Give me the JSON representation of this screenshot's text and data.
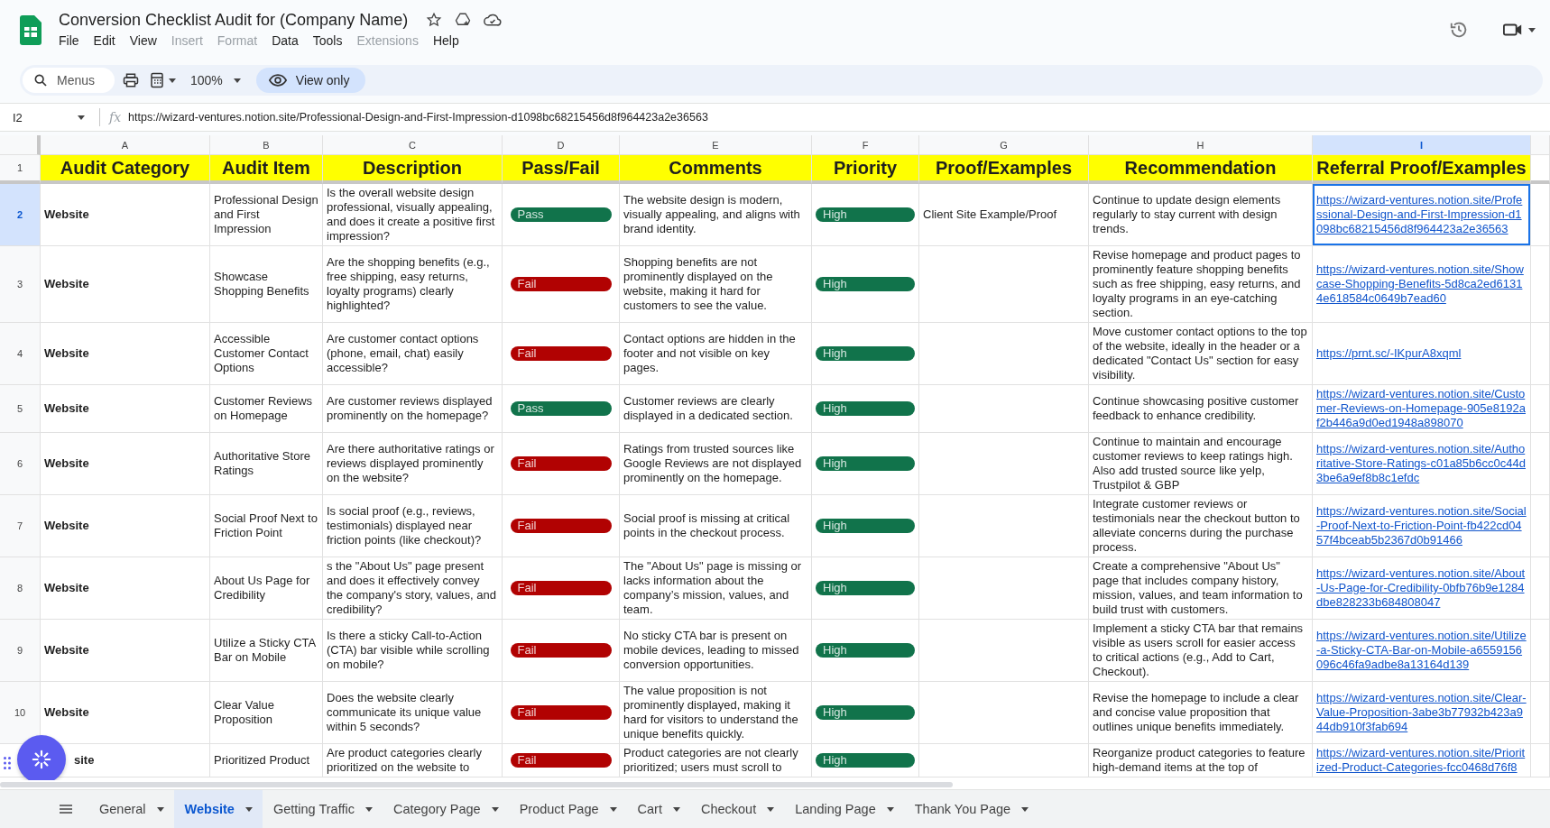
{
  "document": {
    "title": "Conversion Checklist Audit for (Company Name)",
    "menus": [
      {
        "label": "File",
        "disabled": false
      },
      {
        "label": "Edit",
        "disabled": false
      },
      {
        "label": "View",
        "disabled": false
      },
      {
        "label": "Insert",
        "disabled": true
      },
      {
        "label": "Format",
        "disabled": true
      },
      {
        "label": "Data",
        "disabled": false
      },
      {
        "label": "Tools",
        "disabled": false
      },
      {
        "label": "Extensions",
        "disabled": true
      },
      {
        "label": "Help",
        "disabled": false
      }
    ]
  },
  "toolbar": {
    "search": {
      "placeholder": "Menus"
    },
    "zoom": "100%",
    "mode": "View only"
  },
  "formula_bar": {
    "cell": "I2",
    "function_label": "fx",
    "formula": "https://wizard-ventures.notion.site/Professional-Design-and-First-Impression-d1098bc68215456d8f964423a2e36563"
  },
  "sheet": {
    "columns": [
      {
        "letter": "A",
        "selected": false
      },
      {
        "letter": "B",
        "selected": false
      },
      {
        "letter": "C",
        "selected": false
      },
      {
        "letter": "D",
        "selected": false
      },
      {
        "letter": "E",
        "selected": false
      },
      {
        "letter": "F",
        "selected": false
      },
      {
        "letter": "G",
        "selected": false
      },
      {
        "letter": "H",
        "selected": false
      },
      {
        "letter": "I",
        "selected": true
      }
    ],
    "header_row": {
      "number": "1",
      "cells": [
        "Audit Category",
        "Audit Item",
        "Description",
        "Pass/Fail",
        "Comments",
        "Priority",
        "Proof/Examples",
        "Recommendation",
        "Referral Proof/Examples"
      ]
    },
    "rows": [
      {
        "number": "2",
        "selected": true,
        "category": "Website",
        "item": "Professional Design and First Impression",
        "description": "Is the overall website design professional, visually appealing, and does it create a positive first impression?",
        "pass_fail": {
          "label": "Pass",
          "color": "#11734b"
        },
        "comments": "The website design is modern, visually appealing, and aligns with brand identity.",
        "priority": {
          "label": "High",
          "color": "#11734b"
        },
        "proof": "Client Site Example/Proof",
        "recommendation": "Continue to update design elements regularly to stay current with design trends.",
        "referral": {
          "url": "https://wizard-ventures.notion.site/Professional-Design-and-First-Impression-d1098bc68215456d8f964423a2e36563",
          "selected": true
        }
      },
      {
        "number": "3",
        "selected": false,
        "category": "Website",
        "item": "Showcase Shopping Benefits",
        "description": "Are the shopping benefits (e.g., free shipping, easy returns, loyalty programs) clearly highlighted?",
        "pass_fail": {
          "label": "Fail",
          "color": "#b10202"
        },
        "comments": "Shopping benefits are not prominently displayed on the website, making it hard for customers to see the value.",
        "priority": {
          "label": "High",
          "color": "#11734b"
        },
        "recommendation": "Revise homepage and product pages to prominently feature shopping benefits such as free shipping, easy returns, and loyalty programs in an eye-catching section.",
        "referral": {
          "url": "https://wizard-ventures.notion.site/Showcase-Shopping-Benefits-5d8ca2ed61314e618584c0649b7ead60",
          "selected": false
        }
      },
      {
        "number": "4",
        "selected": false,
        "category": "Website",
        "item": "Accessible Customer Contact Options",
        "description": "Are customer contact options (phone, email, chat) easily accessible?",
        "pass_fail": {
          "label": "Fail",
          "color": "#b10202"
        },
        "comments": "Contact options are hidden in the footer and not visible on key pages.",
        "priority": {
          "label": "High",
          "color": "#11734b"
        },
        "recommendation": "Move customer contact options to the top of the website, ideally in the header or a dedicated \"Contact Us\" section for easy visibility.",
        "referral": {
          "url": "https://prnt.sc/-IKpurA8xqml",
          "selected": false
        }
      },
      {
        "number": "5",
        "selected": false,
        "category": "Website",
        "item": "Customer Reviews on Homepage",
        "description": "Are customer reviews displayed prominently on the homepage?",
        "pass_fail": {
          "label": "Pass",
          "color": "#11734b"
        },
        "comments": "Customer reviews are clearly displayed in a dedicated section.",
        "priority": {
          "label": "High",
          "color": "#11734b"
        },
        "recommendation": "Continue showcasing positive customer feedback to enhance credibility.",
        "referral": {
          "url": "https://wizard-ventures.notion.site/Customer-Reviews-on-Homepage-905e8192af2b446a9d0ed1948a898070",
          "selected": false
        }
      },
      {
        "number": "6",
        "selected": false,
        "category": "Website",
        "item": "Authoritative Store Ratings",
        "description": "Are there authoritative ratings or reviews displayed prominently on the website?",
        "pass_fail": {
          "label": "Fail",
          "color": "#b10202"
        },
        "comments": "Ratings from trusted sources like Google Reviews are not displayed prominently on the homepage.",
        "priority": {
          "label": "High",
          "color": "#11734b"
        },
        "recommendation": "Continue to maintain and encourage customer reviews to keep ratings high. Also add trusted source like yelp, Trustpilot & GBP",
        "referral": {
          "url": "https://wizard-ventures.notion.site/Authoritative-Store-Ratings-c01a85b6cc0c44d3be6a9ef8b8c1efdc",
          "selected": false
        }
      },
      {
        "number": "7",
        "selected": false,
        "category": "Website",
        "item": "Social Proof Next to Friction Point",
        "description": "Is social proof (e.g., reviews, testimonials) displayed near friction points (like checkout)?",
        "pass_fail": {
          "label": "Fail",
          "color": "#b10202"
        },
        "comments": "Social proof is missing at critical points in the checkout process.",
        "priority": {
          "label": "High",
          "color": "#11734b"
        },
        "recommendation": "Integrate customer reviews or testimonials near the checkout button to alleviate concerns during the purchase process.",
        "referral": {
          "url": "https://wizard-ventures.notion.site/Social-Proof-Next-to-Friction-Point-fb422cd0457f4bceab5b2367d0b91466",
          "selected": false
        }
      },
      {
        "number": "8",
        "selected": false,
        "category": "Website",
        "item": "About Us Page for Credibility",
        "description": "s the \"About Us\" page present and does it effectively convey the company's story, values, and credibility?",
        "pass_fail": {
          "label": "Fail",
          "color": "#b10202"
        },
        "comments": "The \"About Us\" page is missing or lacks information about the company’s mission, values, and team.",
        "priority": {
          "label": "High",
          "color": "#11734b"
        },
        "recommendation": "Create a comprehensive \"About Us\" page that includes company history, mission, values, and team information to build trust with customers.",
        "referral": {
          "url": "https://wizard-ventures.notion.site/About-Us-Page-for-Credibility-0bfb76b9e1284dbe828233b684808047",
          "selected": false
        }
      },
      {
        "number": "9",
        "selected": false,
        "category": "Website",
        "item": "Utilize a Sticky CTA Bar on Mobile",
        "description": "Is there a sticky Call-to-Action (CTA) bar visible while scrolling on mobile?",
        "pass_fail": {
          "label": "Fail",
          "color": "#b10202"
        },
        "comments": "No sticky CTA bar is present on mobile devices, leading to missed conversion opportunities.",
        "priority": {
          "label": "High",
          "color": "#11734b"
        },
        "recommendation": "Implement a sticky CTA bar that remains visible as users scroll for easier access to critical actions (e.g., Add to Cart, Checkout).",
        "referral": {
          "url": "https://wizard-ventures.notion.site/Utilize-a-Sticky-CTA-Bar-on-Mobile-a6559156096c46fa9adbe8a13164d139",
          "selected": false
        }
      },
      {
        "number": "10",
        "selected": false,
        "category": "Website",
        "item": "Clear Value Proposition",
        "description": "Does the website clearly communicate its unique value within 5 seconds?",
        "pass_fail": {
          "label": "Fail",
          "color": "#b10202"
        },
        "comments": "The value proposition is not prominently displayed, making it hard for visitors to understand the unique benefits quickly.",
        "priority": {
          "label": "High",
          "color": "#11734b"
        },
        "recommendation": "Revise the homepage to include a clear and concise value proposition that outlines unique benefits immediately.",
        "referral": {
          "url": "https://wizard-ventures.notion.site/Clear-Value-Proposition-3abe3b77932b423a944db910f3fab694",
          "selected": false
        }
      },
      {
        "category": "site",
        "item": "Prioritized Product",
        "description": "Are product categories clearly prioritized on the website to",
        "pass_fail": {
          "label": "Fail",
          "color": "#b10202"
        },
        "comments": "Product categories are not clearly prioritized; users must scroll to",
        "priority": {
          "label": "High",
          "color": "#11734b"
        },
        "recommendation": "Reorganize product categories to feature high-demand items at the top of",
        "referral": {
          "url": "https://wizard-ventures.notion.site/Prioritized-Product-Categories-fcc0468d76f8",
          "selected": false
        }
      }
    ]
  },
  "sheet_tabs": [
    {
      "label": "General",
      "selected": false
    },
    {
      "label": "Website",
      "selected": true
    },
    {
      "label": "Getting Traffic",
      "selected": false
    },
    {
      "label": "Category Page",
      "selected": false
    },
    {
      "label": "Product Page",
      "selected": false
    },
    {
      "label": "Cart",
      "selected": false
    },
    {
      "label": "Checkout",
      "selected": false
    },
    {
      "label": "Landing Page",
      "selected": false
    },
    {
      "label": "Thank You Page",
      "selected": false
    }
  ]
}
